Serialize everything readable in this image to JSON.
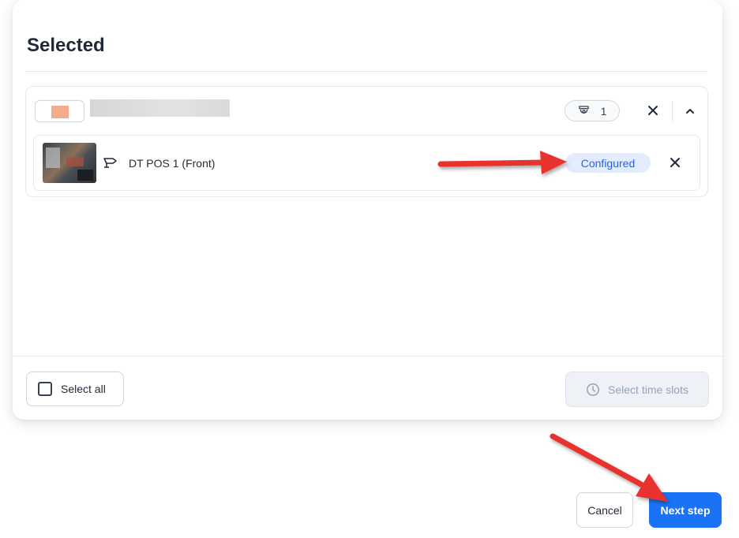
{
  "panel": {
    "title": "Selected",
    "group": {
      "swatch_color": "#f2ac8a",
      "camera_count": "1",
      "count_icon": "dome-camera-icon",
      "remove_icon": "close-icon",
      "collapse_icon": "chevron-up-icon",
      "cameras": [
        {
          "name": "DT POS 1 (Front)",
          "type_icon": "bullet-camera-icon",
          "status": "Configured",
          "remove_icon": "close-icon"
        }
      ]
    },
    "footer": {
      "select_all_label": "Select all",
      "time_slots_label": "Select time slots",
      "time_slots_icon": "clock-icon"
    }
  },
  "actions": {
    "cancel_label": "Cancel",
    "next_label": "Next step"
  },
  "colors": {
    "accent": "#1a73f5",
    "configured_bg": "#e3ecfd",
    "configured_text": "#2563eb",
    "annotation_arrow": "#e8322f"
  }
}
